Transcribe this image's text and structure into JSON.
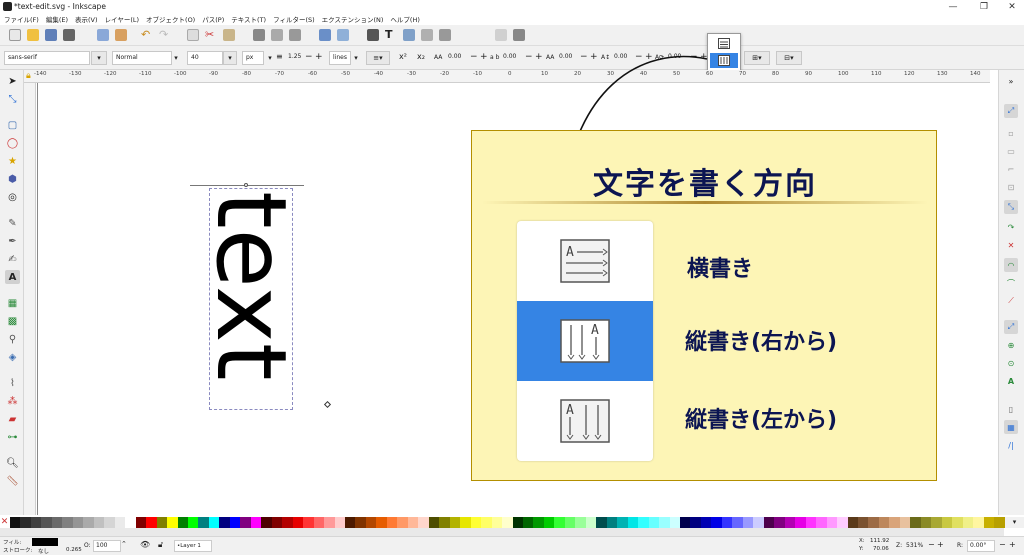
{
  "window": {
    "title": "*text-edit.svg - Inkscape",
    "min": "—",
    "max": "❐",
    "close": "✕"
  },
  "menu": [
    "ファイル(F)",
    "編集(E)",
    "表示(V)",
    "レイヤー(L)",
    "オブジェクト(O)",
    "パス(P)",
    "テキスト(T)",
    "フィルター(S)",
    "エクステンション(N)",
    "ヘルプ(H)"
  ],
  "text_toolbar": {
    "font_family": "sans-serif",
    "font_style": "Normal",
    "font_size": "40",
    "unit": "px",
    "line_spacing": "1.25",
    "spacing_mode": "lines",
    "letter_spacing": "0.00",
    "word_spacing": "0.00",
    "kerning": "0.00",
    "vertical_shift": "0.00",
    "rotation": "0.00"
  },
  "ruler_labels": [
    "-140",
    "-130",
    "-120",
    "-110",
    "-100",
    "-90",
    "-80",
    "-70",
    "-60",
    "-50",
    "-40",
    "-30",
    "-20",
    "-10",
    "0",
    "10",
    "20",
    "30",
    "40",
    "50",
    "60",
    "70",
    "80",
    "90",
    "100",
    "110",
    "120",
    "130",
    "140"
  ],
  "canvas": {
    "vertical_text": "text"
  },
  "callout": {
    "title": "文字を書く方向",
    "options": [
      {
        "label": "横書き",
        "icon": "horizontal-text-icon",
        "selected": false
      },
      {
        "label": "縦書き(右から)",
        "icon": "vertical-rtl-text-icon",
        "selected": true
      },
      {
        "label": "縦書き(左から)",
        "icon": "vertical-ltr-text-icon",
        "selected": false
      }
    ]
  },
  "palette": [
    "#111111",
    "#2b2b2b",
    "#404040",
    "#555555",
    "#6a6a6a",
    "#808080",
    "#959595",
    "#aaaaaa",
    "#c0c0c0",
    "#d5d5d5",
    "#eaeaea",
    "#ffffff",
    "#800000",
    "#ff0000",
    "#808000",
    "#ffff00",
    "#008000",
    "#00ff00",
    "#008080",
    "#00ffff",
    "#000080",
    "#0000ff",
    "#800080",
    "#ff00ff",
    "#4d0000",
    "#800000",
    "#b30000",
    "#e60000",
    "#ff3333",
    "#ff6666",
    "#ff9999",
    "#ffcccc",
    "#4d1a00",
    "#803300",
    "#b34700",
    "#e65c00",
    "#ff7a33",
    "#ff9966",
    "#ffb899",
    "#ffd6cc",
    "#4d4d00",
    "#808000",
    "#b3b300",
    "#e6e600",
    "#ffff33",
    "#ffff66",
    "#ffff99",
    "#ffffcc",
    "#003300",
    "#006600",
    "#009900",
    "#00cc00",
    "#33ff33",
    "#66ff66",
    "#99ff99",
    "#ccffcc",
    "#004d4d",
    "#008080",
    "#00b3b3",
    "#00e6e6",
    "#33ffff",
    "#66ffff",
    "#99ffff",
    "#ccffff",
    "#00004d",
    "#000080",
    "#0000b3",
    "#0000e6",
    "#3333ff",
    "#6666ff",
    "#9999ff",
    "#ccccff",
    "#4d004d",
    "#800080",
    "#b300b3",
    "#e600e6",
    "#ff33ff",
    "#ff66ff",
    "#ff99ff",
    "#ffccff",
    "#5a3a1a",
    "#7a5230",
    "#9c6b45",
    "#bd875c",
    "#d9a47a",
    "#e8c19e",
    "#6b6b1a",
    "#8a8a26",
    "#a8a833",
    "#c8c840",
    "#e0e060",
    "#f0f088",
    "#fff6a0",
    "#c8b000",
    "#b8a000"
  ],
  "status": {
    "fill_label": "フィル:",
    "stroke_label": "ストローク:",
    "stroke_value": "なし",
    "stroke_width": "0.265",
    "opacity_label": "O:",
    "opacity": "100",
    "layer": "•Layer 1",
    "x_label": "X:",
    "x": "111.92",
    "y_label": "Y:",
    "y": "70.06",
    "zoom_label": "Z:",
    "zoom": "531%",
    "rotation_label": "R:",
    "rotation": "0.00°",
    "fill_color": "#000000"
  }
}
